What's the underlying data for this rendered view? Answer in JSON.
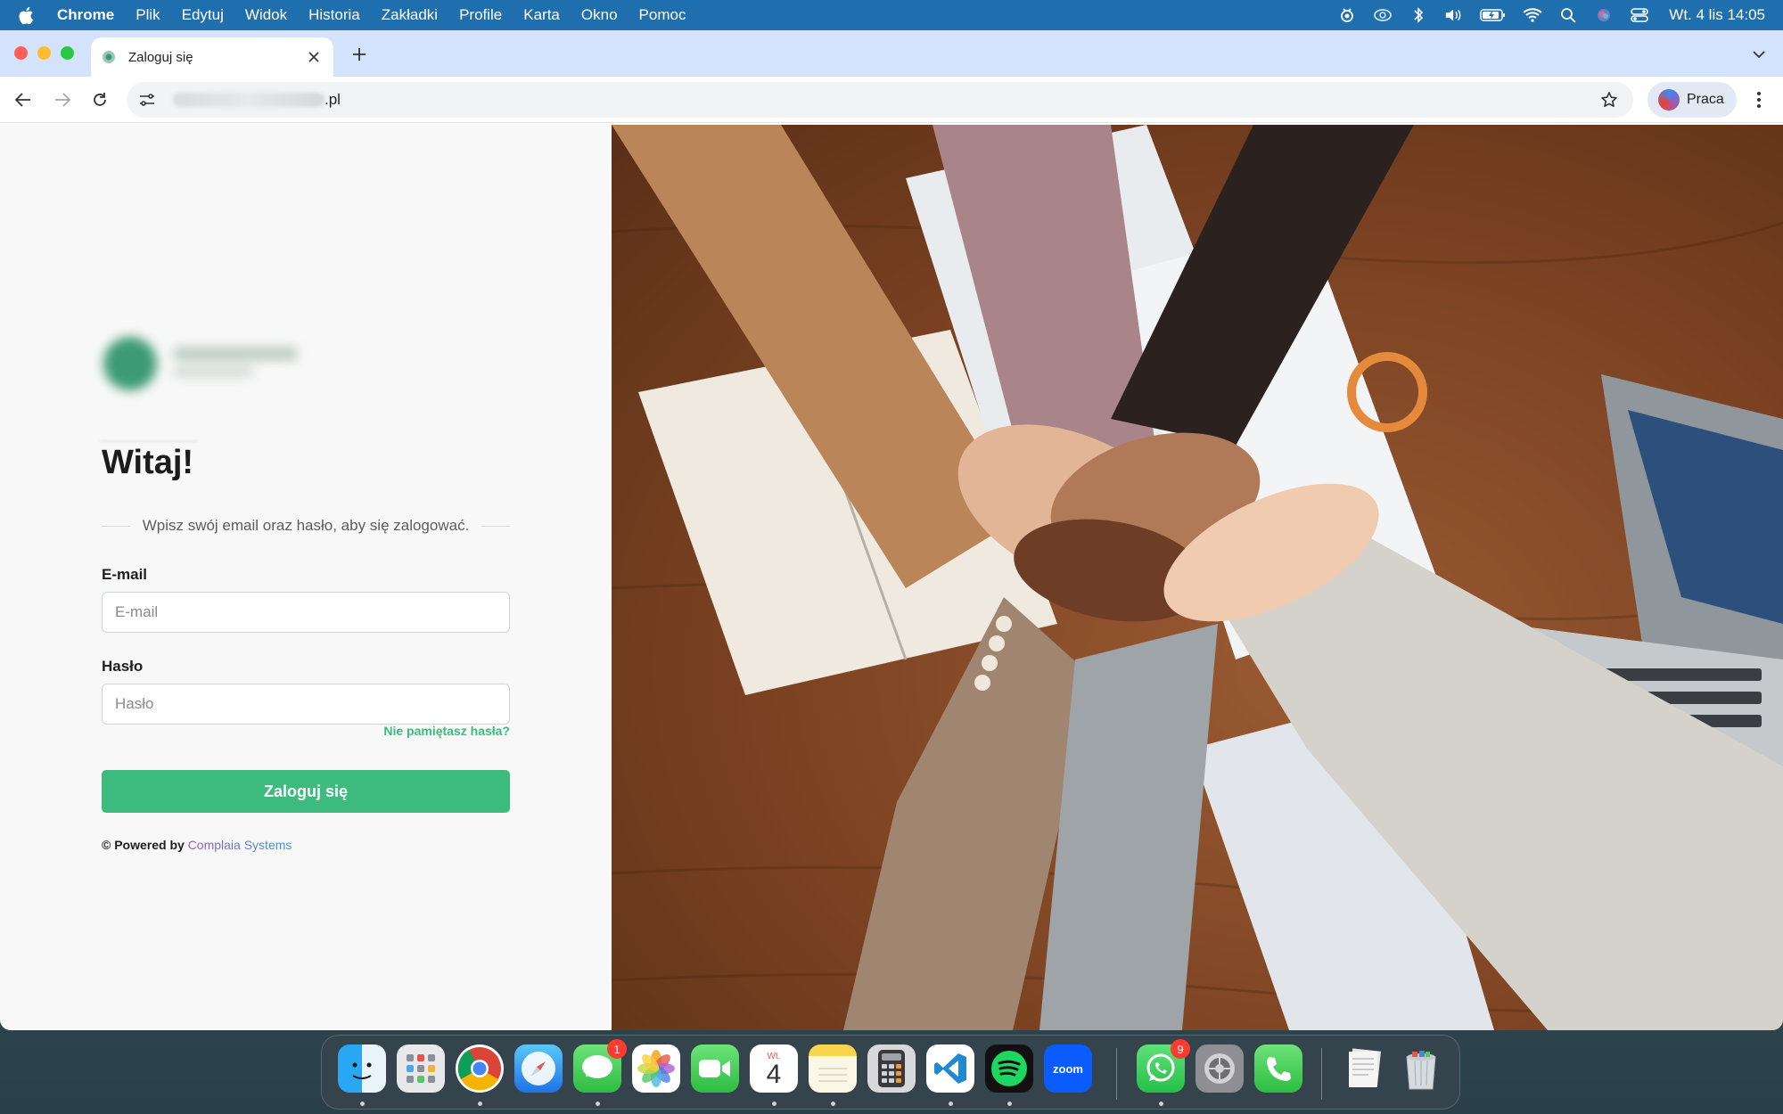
{
  "menubar": {
    "app_name": "Chrome",
    "items": [
      "Plik",
      "Edytuj",
      "Widok",
      "Historia",
      "Zakładki",
      "Profile",
      "Karta",
      "Okno",
      "Pomoc"
    ],
    "clock": "Wt. 4 lis  14:05",
    "status_icons": [
      "screen-record-icon",
      "creative-cloud-icon",
      "bluetooth-icon",
      "volume-icon",
      "battery-icon",
      "wifi-icon",
      "search-icon",
      "siri-icon",
      "control-center-icon"
    ]
  },
  "browser": {
    "tab_title": "Zaloguj się",
    "url_suffix": ".pl",
    "profile_name": "Praca"
  },
  "login": {
    "welcome": "Witaj!",
    "subtitle": "Wpisz swój email oraz hasło, aby się zalogować.",
    "email_label": "E-mail",
    "email_placeholder": "E-mail",
    "email_value": "",
    "password_label": "Hasło",
    "password_placeholder": "Hasło",
    "password_value": "",
    "forgot_link": "Nie pamiętasz hasła?",
    "submit_label": "Zaloguj się",
    "powered_prefix": "© Powered by",
    "powered_brand": "Complaia Systems"
  },
  "colors": {
    "accent_green": "#3dba7e",
    "menubar_blue": "#1f6fae",
    "tabstrip": "#d3e3fd",
    "brand_gradient_start": "#9b59b6",
    "brand_gradient_end": "#3498db"
  },
  "dock": {
    "apps": [
      {
        "name": "Finder",
        "icon": "finder-icon"
      },
      {
        "name": "Launchpad",
        "icon": "launchpad-icon"
      },
      {
        "name": "Chrome",
        "icon": "chrome-icon"
      },
      {
        "name": "Safari",
        "icon": "safari-icon"
      },
      {
        "name": "Messages",
        "icon": "messages-icon",
        "badge": "1"
      },
      {
        "name": "Photos",
        "icon": "photos-icon"
      },
      {
        "name": "FaceTime",
        "icon": "facetime-icon"
      },
      {
        "name": "Calendar",
        "icon": "calendar-icon",
        "month": "Wt.",
        "day": "4"
      },
      {
        "name": "Notes",
        "icon": "notes-icon"
      },
      {
        "name": "Calculator",
        "icon": "calculator-icon"
      },
      {
        "name": "VS Code",
        "icon": "vscode-icon"
      },
      {
        "name": "Spotify",
        "icon": "spotify-icon"
      },
      {
        "name": "Zoom",
        "icon": "zoom-icon",
        "text": "zoom"
      },
      {
        "name": "WhatsApp",
        "icon": "whatsapp-icon",
        "badge": "9"
      },
      {
        "name": "System Settings",
        "icon": "settings-icon"
      },
      {
        "name": "Phone",
        "icon": "phone-icon"
      },
      {
        "name": "Documents",
        "icon": "documents-stack-icon"
      },
      {
        "name": "Trash",
        "icon": "trash-icon"
      }
    ]
  }
}
